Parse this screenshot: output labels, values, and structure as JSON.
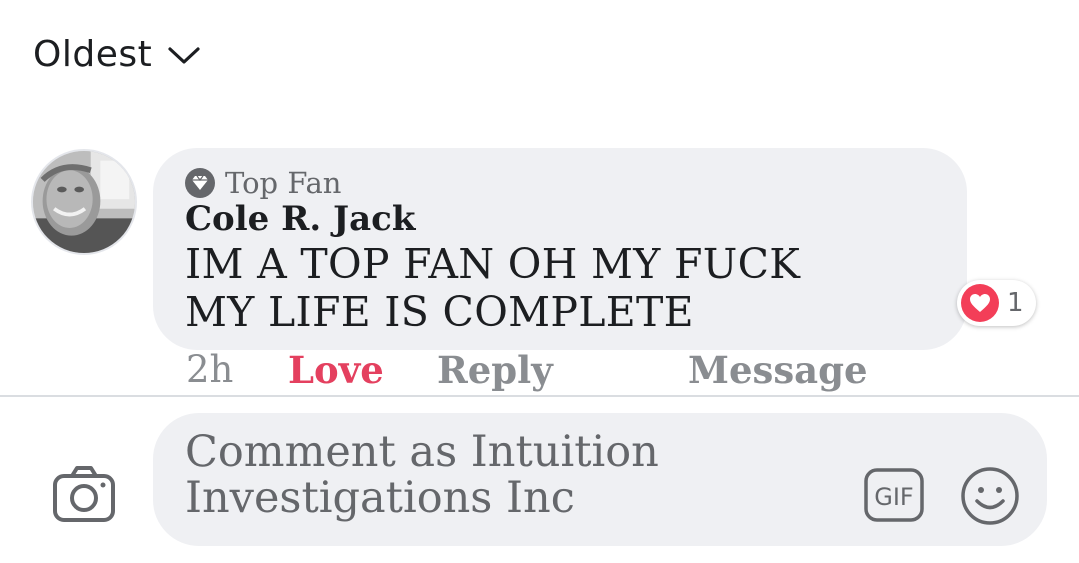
{
  "sort": {
    "label": "Oldest",
    "icon": "chevron-down-icon"
  },
  "comment": {
    "badge_icon": "diamond-icon",
    "badge_label": "Top Fan",
    "author": "Cole R. Jack",
    "text_line1": "IM A TOP FAN OH MY FUCK",
    "text_line2": "MY LIFE IS COMPLETE",
    "reaction": {
      "icon": "heart-icon",
      "color": "#f33e58",
      "count": "1"
    },
    "actions": {
      "time": "2h",
      "love": "Love",
      "reply": "Reply",
      "message": "Message"
    },
    "love_color": "#e4405f"
  },
  "composer": {
    "placeholder": "Comment as Intuition Investigations Inc",
    "camera_icon": "camera-icon",
    "gif_icon": "gif-icon",
    "gif_label": "GIF",
    "emoji_icon": "smiley-icon"
  }
}
